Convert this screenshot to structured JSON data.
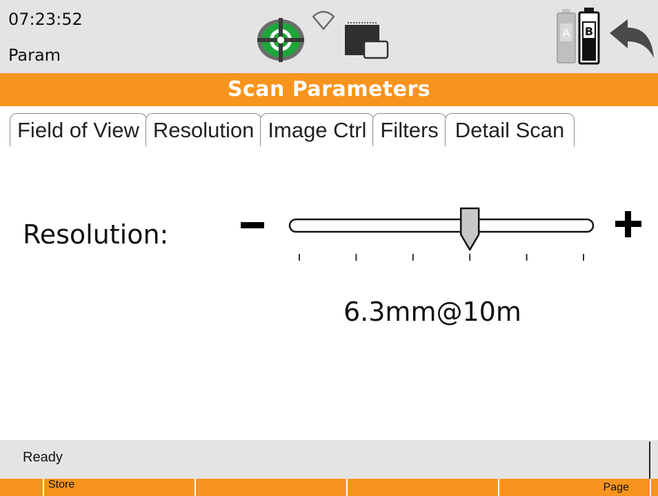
{
  "header": {
    "time": "07:23:52",
    "mode": "Param",
    "icons": [
      "level-icon",
      "wifi-icon",
      "sd-card-icon",
      "battery-a-icon",
      "battery-b-icon",
      "back-arrow-icon"
    ],
    "battery_a_label": "A",
    "battery_b_label": "B"
  },
  "title": "Scan Parameters",
  "tabs": [
    {
      "label": "Field of View",
      "active": false
    },
    {
      "label": "Resolution",
      "active": false
    },
    {
      "label": "Image Ctrl",
      "active": false
    },
    {
      "label": "Filters",
      "active": false
    },
    {
      "label": "Detail Scan",
      "active": true
    }
  ],
  "resolution": {
    "label": "Resolution:",
    "value": "6.3mm@10m",
    "tick_count": 6,
    "selected_tick_index": 3,
    "decrease_symbol": "minus-icon",
    "increase_symbol": "plus-icon"
  },
  "status": {
    "text": "Ready"
  },
  "softkeys": {
    "f1": "Store",
    "f2": "",
    "f3": "",
    "f4": "Page"
  },
  "colors": {
    "accent": "#f7941d",
    "header_bg": "#e4e4e4",
    "title_text": "#ffffff",
    "level_green": "#1fa53a"
  }
}
